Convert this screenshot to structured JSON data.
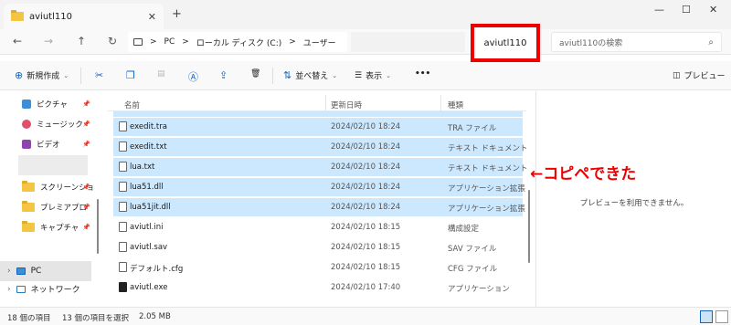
{
  "tab": {
    "title": "aviutl110",
    "close": "✕",
    "new": "+"
  },
  "window": {
    "min": "—",
    "max": "☐",
    "close": "✕"
  },
  "nav": {
    "back": "←",
    "forward": "→",
    "up": "↑",
    "refresh": "↻"
  },
  "breadcrumb": {
    "sep1": ">",
    "pc": "PC",
    "sep2": ">",
    "drive": "ローカル ディスク (C:)",
    "sep3": ">",
    "users": "ユーザー"
  },
  "highlight": {
    "folder": "aviutl110"
  },
  "search": {
    "placeholder": "aviutl110の検索",
    "icon": "search-icon"
  },
  "toolbar": {
    "new": "新規作成",
    "sort": "並べ替え",
    "view": "表示",
    "more": "•••",
    "preview": "プレビュー"
  },
  "sidebar": {
    "items": [
      {
        "label": "ピクチャ",
        "color": "#3b8fd8"
      },
      {
        "label": "ミュージック",
        "color": "#e0506a"
      },
      {
        "label": "ビデオ",
        "color": "#8e44ad"
      },
      {
        "label": "スクリーンショ",
        "color": "#f4c542"
      },
      {
        "label": "プレミアプロ",
        "color": "#f4c542"
      },
      {
        "label": "キャプチャ",
        "color": "#f4c542"
      }
    ],
    "pc": "PC",
    "network": "ネットワーク"
  },
  "columns": {
    "name": "名前",
    "date": "更新日時",
    "type": "種類"
  },
  "files": [
    {
      "name": "exedit.tra",
      "date": "2024/02/10 18:24",
      "type": "TRA ファイル",
      "selected": true
    },
    {
      "name": "exedit.txt",
      "date": "2024/02/10 18:24",
      "type": "テキスト ドキュメント",
      "selected": true
    },
    {
      "name": "lua.txt",
      "date": "2024/02/10 18:24",
      "type": "テキスト ドキュメント",
      "selected": true
    },
    {
      "name": "lua51.dll",
      "date": "2024/02/10 18:24",
      "type": "アプリケーション拡張",
      "selected": true
    },
    {
      "name": "lua51jit.dll",
      "date": "2024/02/10 18:24",
      "type": "アプリケーション拡張",
      "selected": true
    },
    {
      "name": "aviutl.ini",
      "date": "2024/02/10 18:15",
      "type": "構成設定",
      "selected": false
    },
    {
      "name": "aviutl.sav",
      "date": "2024/02/10 18:15",
      "type": "SAV ファイル",
      "selected": false
    },
    {
      "name": "デフォルト.cfg",
      "date": "2024/02/10 18:15",
      "type": "CFG ファイル",
      "selected": false
    },
    {
      "name": "aviutl.exe",
      "date": "2024/02/10 17:40",
      "type": "アプリケーション",
      "selected": false
    }
  ],
  "preview": {
    "message": "プレビューを利用できません。"
  },
  "annotation": "←コピペできた",
  "status": {
    "count": "18 個の項目",
    "selected": "13 個の項目を選択",
    "size": "2.05 MB"
  }
}
